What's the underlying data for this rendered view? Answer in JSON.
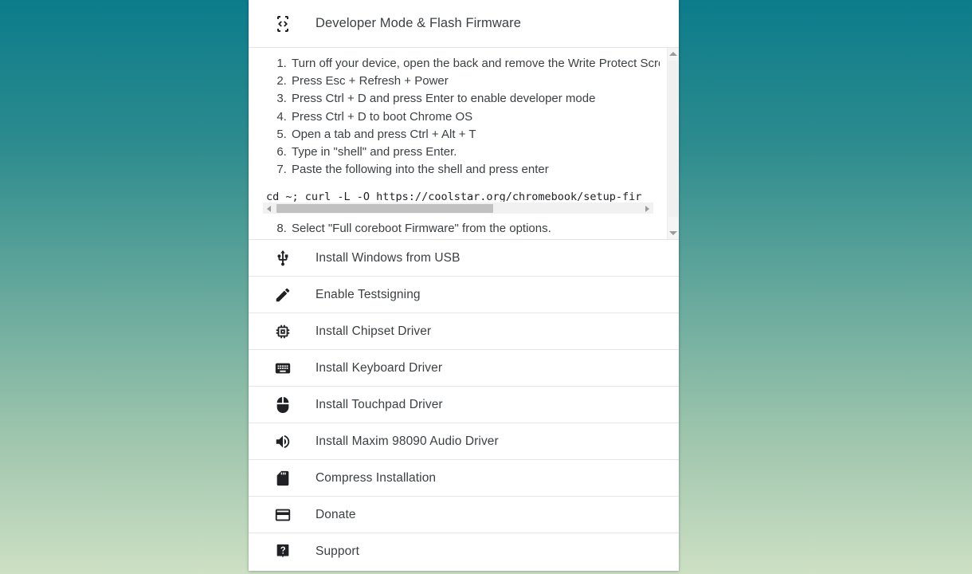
{
  "window": {
    "background_top_color": "#0c7c8b",
    "background_bottom_color": "#cde0c4"
  },
  "header": {
    "title": "Developer Mode & Flash Firmware",
    "icon": "developer-mode-icon"
  },
  "instructions": {
    "steps_before_code": [
      "Turn off your device, open the back and remove the Write Protect Screw.",
      "Press Esc + Refresh + Power",
      "Press Ctrl + D and press Enter to enable developer mode",
      "Press Ctrl + D to boot Chrome OS",
      "Open a tab and press Ctrl + Alt + T",
      "Type in \"shell\" and press Enter.",
      "Paste the following into the shell and press enter"
    ],
    "code": "cd ~; curl -L -O https://coolstar.org/chromebook/setup-fir",
    "steps_after_code": [
      "Select \"Full coreboot Firmware\" from the options."
    ]
  },
  "menu": {
    "items": [
      {
        "label": "Install Windows from USB",
        "icon": "usb-icon"
      },
      {
        "label": "Enable Testsigning",
        "icon": "pencil-icon"
      },
      {
        "label": "Install Chipset Driver",
        "icon": "chip-icon"
      },
      {
        "label": "Install Keyboard Driver",
        "icon": "keyboard-icon"
      },
      {
        "label": "Install Touchpad Driver",
        "icon": "mouse-icon"
      },
      {
        "label": "Install Maxim 98090 Audio Driver",
        "icon": "speaker-icon"
      },
      {
        "label": "Compress Installation",
        "icon": "sd-card-icon"
      },
      {
        "label": "Donate",
        "icon": "credit-card-icon"
      },
      {
        "label": "Support",
        "icon": "help-bubble-icon"
      }
    ]
  }
}
